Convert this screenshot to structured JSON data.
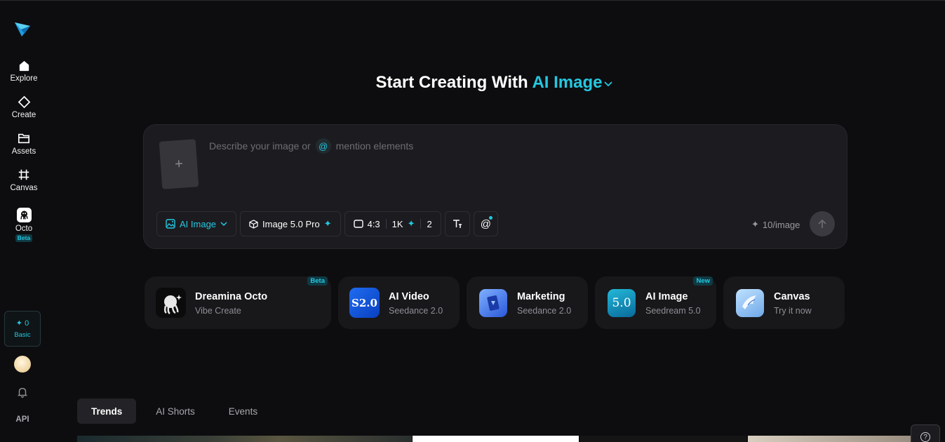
{
  "sidebar": {
    "items": [
      {
        "label": "Explore",
        "icon": "home-icon"
      },
      {
        "label": "Create",
        "icon": "diamond-icon"
      },
      {
        "label": "Assets",
        "icon": "folder-icon"
      },
      {
        "label": "Canvas",
        "icon": "frame-icon"
      },
      {
        "label": "Octo",
        "icon": "octopus-icon",
        "badge": "Beta"
      }
    ],
    "credits": {
      "count": "0",
      "plan": "Basic"
    },
    "api_label": "API"
  },
  "headline": {
    "prefix": "Start Creating With",
    "mode": "AI Image"
  },
  "prompt": {
    "placeholder_start": "Describe your image or",
    "mention_symbol": "@",
    "placeholder_end": "mention elements",
    "upload_symbol": "+"
  },
  "toolbar": {
    "mode_label": "AI Image",
    "model_label": "Image 5.0 Pro",
    "ratio": "4:3",
    "resolution": "1K",
    "count": "2",
    "mention_symbol": "@",
    "cost": "10/image"
  },
  "cards": [
    {
      "title": "Dreamina Octo",
      "subtitle": "Vibe Create",
      "tag": "Beta"
    },
    {
      "title": "AI Video",
      "subtitle": "Seedance 2.0",
      "tag": "",
      "thumb_text": "S2.0"
    },
    {
      "title": "Marketing",
      "subtitle": "Seedance 2.0",
      "tag": ""
    },
    {
      "title": "AI Image",
      "subtitle": "Seedream 5.0",
      "tag": "New",
      "thumb_text": "5.0"
    },
    {
      "title": "Canvas",
      "subtitle": "Try it now",
      "tag": ""
    }
  ],
  "tabs": [
    {
      "label": "Trends",
      "active": true
    },
    {
      "label": "AI Shorts",
      "active": false
    },
    {
      "label": "Events",
      "active": false
    }
  ],
  "help_symbol": "?",
  "colors": {
    "accent": "#24c8e0",
    "background": "#0d0d0f",
    "panel": "#1c1c20"
  }
}
